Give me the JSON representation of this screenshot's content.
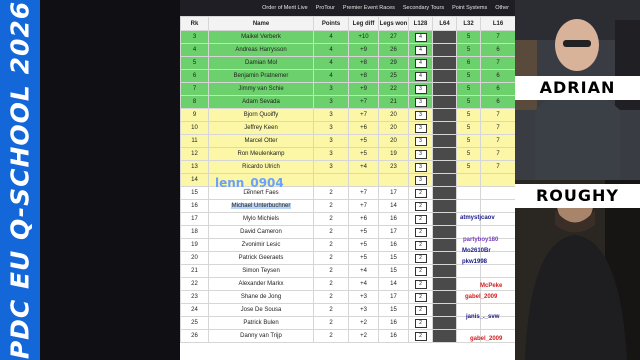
{
  "banner": {
    "text": "PDC EU Q-SCHOOL 2026",
    "color": "#1467d8"
  },
  "nav": {
    "items": [
      "Order of Merit Live",
      "ProTour",
      "Premier Event Races",
      "Secondary Tours",
      "Point Systems",
      "Other"
    ]
  },
  "table": {
    "headers": [
      "Rk",
      "Name",
      "Points",
      "Leg diff",
      "Legs won",
      "L128",
      "L64",
      "L32",
      "L16"
    ],
    "rows": [
      {
        "rank": "3",
        "name": "Maikel Verberk",
        "points": "4",
        "diff": "+10",
        "won": "27",
        "tier": "green",
        "cols": [
          "4",
          "",
          "5",
          "7"
        ]
      },
      {
        "rank": "4",
        "name": "Andreas Harrysson",
        "points": "4",
        "diff": "+9",
        "won": "26",
        "tier": "green",
        "cols": [
          "4",
          "",
          "5",
          "6"
        ]
      },
      {
        "rank": "5",
        "name": "Damian Mol",
        "points": "4",
        "diff": "+8",
        "won": "29",
        "tier": "green",
        "cols": [
          "4",
          "",
          "6",
          "7"
        ]
      },
      {
        "rank": "6",
        "name": "Benjamin Pratnemer",
        "points": "4",
        "diff": "+8",
        "won": "25",
        "tier": "green",
        "cols": [
          "4",
          "",
          "5",
          "6"
        ]
      },
      {
        "rank": "7",
        "name": "Jimmy van Schie",
        "points": "3",
        "diff": "+9",
        "won": "22",
        "tier": "green",
        "cols": [
          "3",
          "",
          "5",
          "6"
        ]
      },
      {
        "rank": "8",
        "name": "Adam Sevada",
        "points": "3",
        "diff": "+7",
        "won": "21",
        "tier": "green",
        "cols": [
          "3",
          "",
          "5",
          "6"
        ]
      },
      {
        "rank": "9",
        "name": "Bjorn Quoiffy",
        "points": "3",
        "diff": "+7",
        "won": "20",
        "tier": "yellow",
        "cols": [
          "3",
          "",
          "5",
          "7"
        ]
      },
      {
        "rank": "10",
        "name": "Jeffrey Keen",
        "points": "3",
        "diff": "+6",
        "won": "20",
        "tier": "yellow",
        "cols": [
          "3",
          "",
          "5",
          "7"
        ]
      },
      {
        "rank": "11",
        "name": "Marcel Otter",
        "points": "3",
        "diff": "+5",
        "won": "20",
        "tier": "yellow",
        "cols": [
          "3",
          "",
          "5",
          "7"
        ]
      },
      {
        "rank": "12",
        "name": "Ron Meulenkamp",
        "points": "3",
        "diff": "+5",
        "won": "19",
        "tier": "yellow",
        "cols": [
          "3",
          "",
          "5",
          "7"
        ]
      },
      {
        "rank": "13",
        "name": "Ricardo Ulrich",
        "points": "3",
        "diff": "+4",
        "won": "23",
        "tier": "yellow",
        "cols": [
          "3",
          "",
          "5",
          "7"
        ]
      },
      {
        "rank": "14",
        "name": "",
        "points": "",
        "diff": "",
        "won": "",
        "tier": "yellow",
        "cols": [
          "3",
          "",
          "",
          ""
        ]
      },
      {
        "rank": "15",
        "name": "Lennert Faes",
        "points": "2",
        "diff": "+7",
        "won": "17",
        "tier": "white",
        "cols": [
          "2",
          "",
          "",
          ""
        ]
      },
      {
        "rank": "16",
        "name": "Michael Unterbuchner",
        "points": "2",
        "diff": "+7",
        "won": "14",
        "tier": "white",
        "cols": [
          "2",
          "",
          "",
          ""
        ]
      },
      {
        "rank": "17",
        "name": "Mylo Michiels",
        "points": "2",
        "diff": "+6",
        "won": "16",
        "tier": "white",
        "cols": [
          "2",
          "",
          "",
          ""
        ]
      },
      {
        "rank": "18",
        "name": "David Cameron",
        "points": "2",
        "diff": "+5",
        "won": "17",
        "tier": "white",
        "cols": [
          "2",
          "",
          "",
          ""
        ]
      },
      {
        "rank": "19",
        "name": "Zvonimir Lesic",
        "points": "2",
        "diff": "+5",
        "won": "16",
        "tier": "white",
        "cols": [
          "2",
          "",
          "",
          ""
        ]
      },
      {
        "rank": "20",
        "name": "Patrick Geeraets",
        "points": "2",
        "diff": "+5",
        "won": "15",
        "tier": "white",
        "cols": [
          "2",
          "",
          "",
          ""
        ]
      },
      {
        "rank": "21",
        "name": "Simon Teysen",
        "points": "2",
        "diff": "+4",
        "won": "15",
        "tier": "white",
        "cols": [
          "2",
          "",
          "",
          ""
        ]
      },
      {
        "rank": "22",
        "name": "Alexander Markx",
        "points": "2",
        "diff": "+4",
        "won": "14",
        "tier": "white",
        "cols": [
          "2",
          "",
          "",
          ""
        ]
      },
      {
        "rank": "23",
        "name": "Shane de Jong",
        "points": "2",
        "diff": "+3",
        "won": "17",
        "tier": "white",
        "cols": [
          "2",
          "",
          "",
          ""
        ]
      },
      {
        "rank": "24",
        "name": "Jose De Sousa",
        "points": "2",
        "diff": "+3",
        "won": "15",
        "tier": "white",
        "cols": [
          "2",
          "",
          "",
          ""
        ]
      },
      {
        "rank": "25",
        "name": "Patrick Bulen",
        "points": "2",
        "diff": "+2",
        "won": "16",
        "tier": "white",
        "cols": [
          "2",
          "",
          "",
          ""
        ]
      },
      {
        "rank": "26",
        "name": "Danny van Trijp",
        "points": "2",
        "diff": "+2",
        "won": "16",
        "tier": "white",
        "cols": [
          "2",
          "",
          "",
          ""
        ]
      }
    ]
  },
  "overlay_user": "lenn_0904",
  "chat": [
    {
      "user": "atmystjcaov",
      "color": "#1a1a8a"
    },
    {
      "user": "partyboy180",
      "color": "#7b3fbf"
    },
    {
      "user": "Mo2610Br",
      "color": "#1a1a8a"
    },
    {
      "user": "pkw1998",
      "color": "#1a1a8a"
    },
    {
      "user": "McPeke",
      "color": "#d42020"
    },
    {
      "user": "gabel_2009",
      "color": "#d42020"
    },
    {
      "user": "janis_._svw",
      "color": "#1a1a8a"
    },
    {
      "user": "gabel_2009",
      "color": "#d42020"
    }
  ],
  "cams": {
    "top_name": "ADRIAN",
    "bottom_name": "ROUGHY"
  }
}
